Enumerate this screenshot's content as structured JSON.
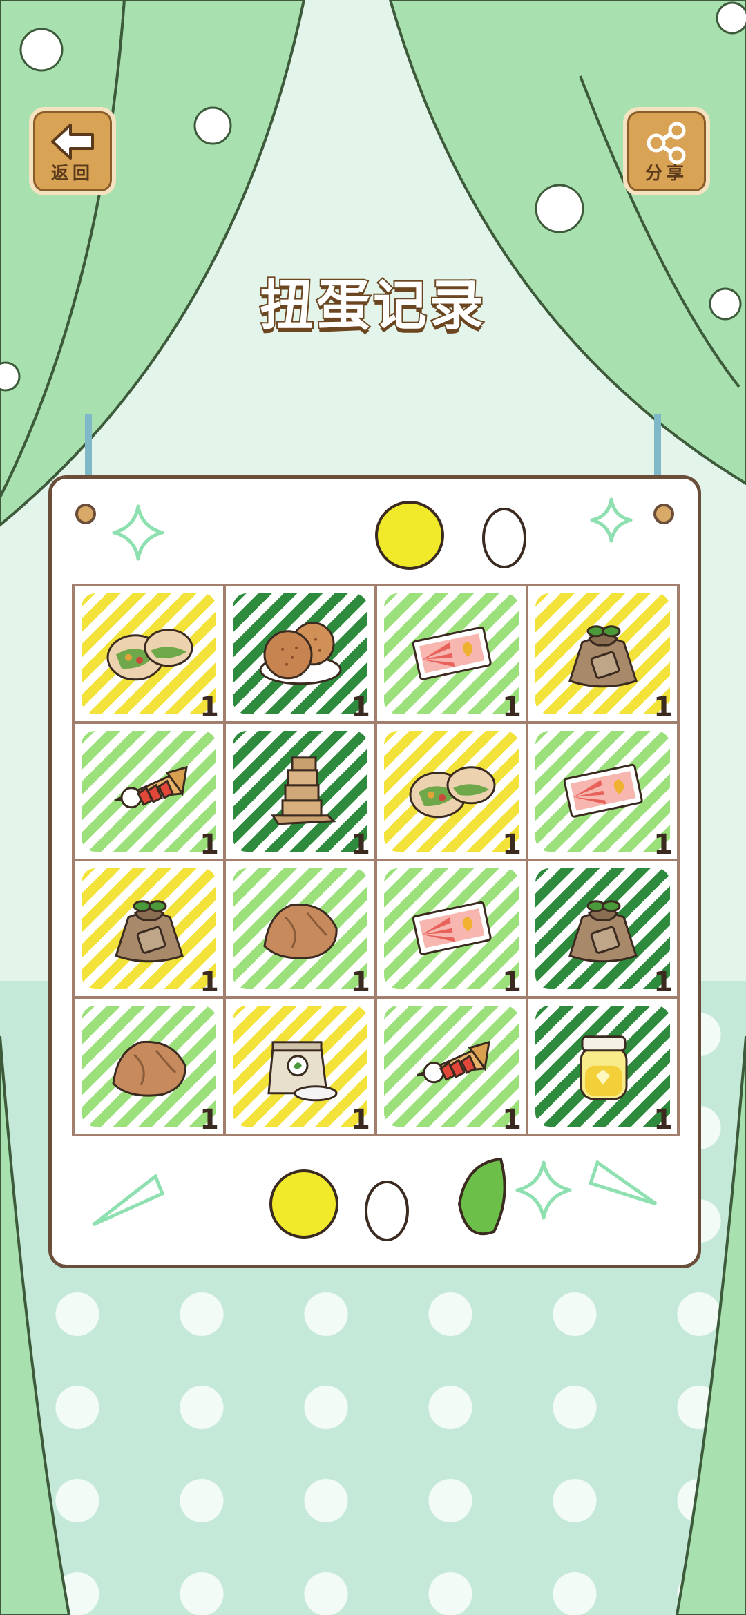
{
  "header": {
    "back_label": "返回",
    "share_label": "分享",
    "title": "扭蛋记录"
  },
  "colors": {
    "yellow_scribble": "#f2e23a",
    "light_green_scribble": "#9be07a",
    "dark_green_scribble": "#2e8a3c",
    "panel_border": "#6b4e3a",
    "grid_line": "#a27e6c"
  },
  "items": [
    {
      "name": "pita-bread",
      "scribble": "yellow",
      "count": "1"
    },
    {
      "name": "crackers",
      "scribble": "dark",
      "count": "1"
    },
    {
      "name": "ticket",
      "scribble": "light",
      "count": "1"
    },
    {
      "name": "seed-bag",
      "scribble": "yellow",
      "count": "1"
    },
    {
      "name": "crepe",
      "scribble": "light",
      "count": "1"
    },
    {
      "name": "wood-stack",
      "scribble": "dark",
      "count": "1"
    },
    {
      "name": "pita-bread",
      "scribble": "yellow",
      "count": "1"
    },
    {
      "name": "ticket",
      "scribble": "light",
      "count": "1"
    },
    {
      "name": "seed-bag",
      "scribble": "yellow",
      "count": "1"
    },
    {
      "name": "rock",
      "scribble": "light",
      "count": "1"
    },
    {
      "name": "ticket",
      "scribble": "light",
      "count": "1"
    },
    {
      "name": "seed-bag",
      "scribble": "dark",
      "count": "1"
    },
    {
      "name": "rock",
      "scribble": "light",
      "count": "1"
    },
    {
      "name": "flour-bag",
      "scribble": "yellow",
      "count": "1"
    },
    {
      "name": "crepe",
      "scribble": "light",
      "count": "1"
    },
    {
      "name": "honey-jar",
      "scribble": "dark",
      "count": "1"
    }
  ]
}
